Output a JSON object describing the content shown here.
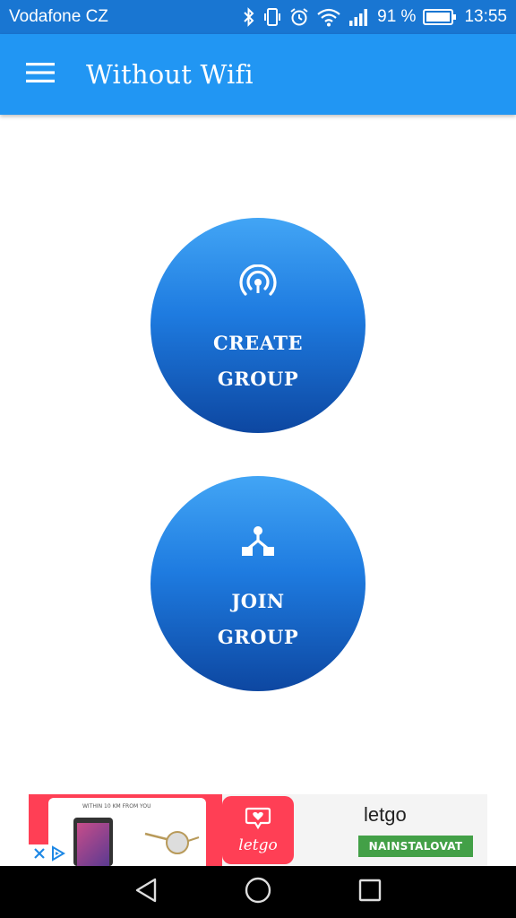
{
  "status_bar": {
    "carrier": "Vodafone CZ",
    "battery_percent": "91 %",
    "time": "13:55",
    "icons": [
      "bluetooth-icon",
      "vibrate-icon",
      "alarm-icon",
      "wifi-icon",
      "signal-icon",
      "battery-icon"
    ]
  },
  "app_bar": {
    "title": "Without Wifi",
    "menu_icon": "hamburger-menu-icon",
    "color": "#2196F3",
    "status_color": "#1976D2"
  },
  "main": {
    "create_group": {
      "line1": "CREATE",
      "line2": "GROUP",
      "icon": "hotspot-icon"
    },
    "join_group": {
      "line1": "JOIN",
      "line2": "GROUP",
      "icon": "network-join-icon"
    },
    "button_gradient": [
      "#42A5F5",
      "#0D47A1"
    ]
  },
  "ad": {
    "image_caption": "WITHIN 10 KM FROM YOU",
    "logo_text": "letgo",
    "app_name": "letgo",
    "cta_label": "NAINSTALOVAT",
    "cta_color": "#43A047",
    "brand_color": "#FF3F55"
  },
  "nav_bar": {
    "icons": [
      "back-icon",
      "home-icon",
      "recents-icon"
    ]
  }
}
